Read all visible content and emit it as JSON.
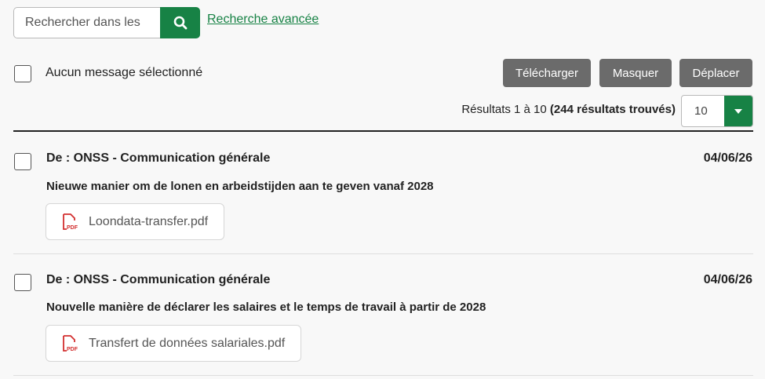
{
  "search": {
    "placeholder": "Rechercher dans les",
    "advanced_link": "Recherche avancée"
  },
  "toolbar": {
    "selection_label": "Aucun message sélectionné",
    "download_label": "Télécharger",
    "hide_label": "Masquer",
    "move_label": "Déplacer"
  },
  "results": {
    "range_text": "Résultats 1 à 10",
    "total_text": "(244 résultats trouvés)",
    "page_size": "10"
  },
  "messages": [
    {
      "from": "De : ONSS - Communication générale",
      "date": "04/06/26",
      "subject": "Nieuwe manier om de lonen en arbeidstijden aan te geven vanaf 2028",
      "attachment": "Loondata-transfer.pdf"
    },
    {
      "from": "De : ONSS - Communication générale",
      "date": "04/06/26",
      "subject": "Nouvelle manière de déclarer les salaires et le temps de travail à partir de 2028",
      "attachment": "Transfert de données salariales.pdf"
    }
  ],
  "colors": {
    "accent": "#178245",
    "button_gray": "#6b6b6b",
    "pdf_red": "#d32f2f"
  },
  "icons": {
    "search": "search-icon",
    "caret": "chevron-down-icon",
    "attachment": "pdf-icon"
  }
}
